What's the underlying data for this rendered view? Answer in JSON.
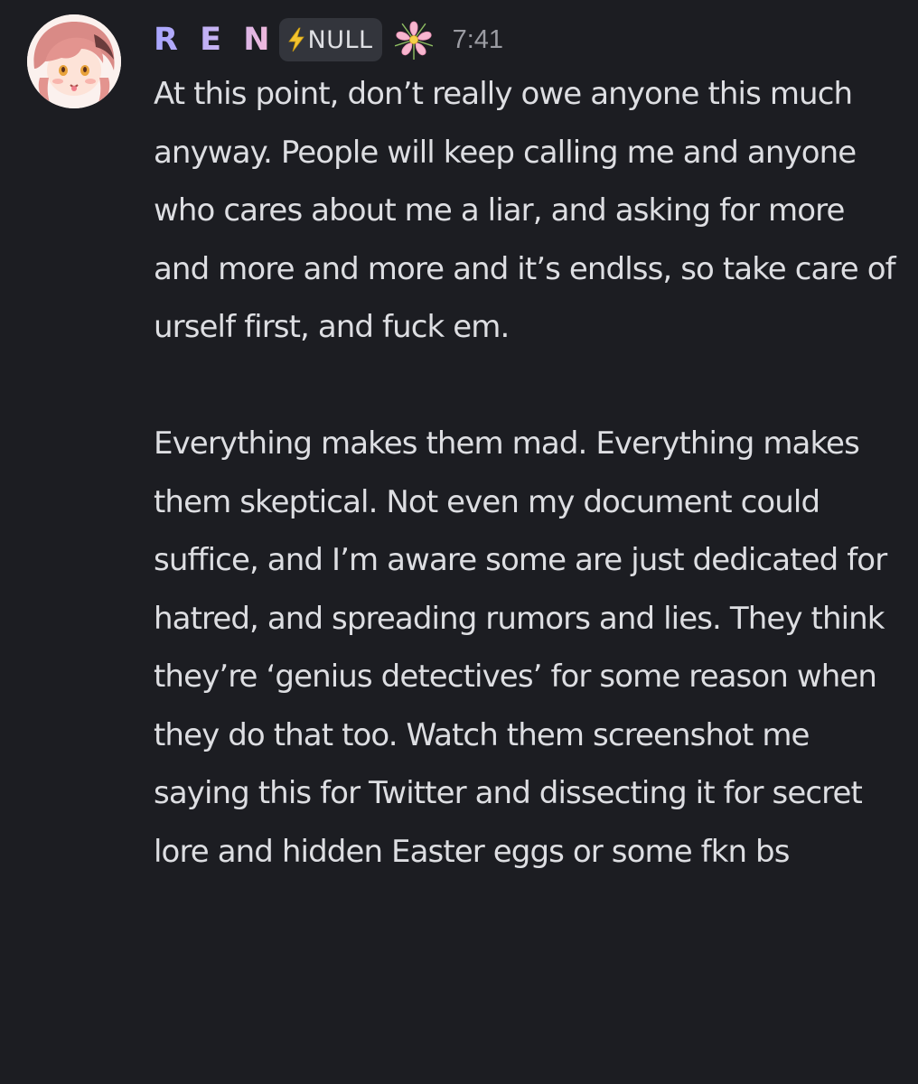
{
  "message": {
    "author": {
      "name": "R E N",
      "tag": "NULL",
      "tag_icon": "lightning-bolt-icon",
      "role_icon": "sakura-flower-icon",
      "avatar": "anime-girl-pink-hair-avatar"
    },
    "timestamp": "7:41",
    "paragraphs": [
      "At this point, don’t really owe anyone this much anyway. People will keep calling me and anyone who cares about me a liar, and asking for more and more and more and it’s endlss, so take care of urself first, and fuck em.",
      "Everything makes them mad. Everything makes them skeptical. Not even my document could  suffice, and I’m aware some are just dedicated for hatred, and spreading rumors and lies. They think they’re ‘genius detectives’ for some reason when they do that too. Watch them screenshot me saying this for Twitter and dissecting it for secret lore and hidden Easter eggs or some fkn bs"
    ]
  },
  "colors": {
    "background": "#1c1d22",
    "text": "#dddee2",
    "timestamp": "#9b9ca3",
    "tag_background": "#33353c",
    "name_gradient_start": "#a8a6ff",
    "name_gradient_end": "#f5b8d8"
  }
}
